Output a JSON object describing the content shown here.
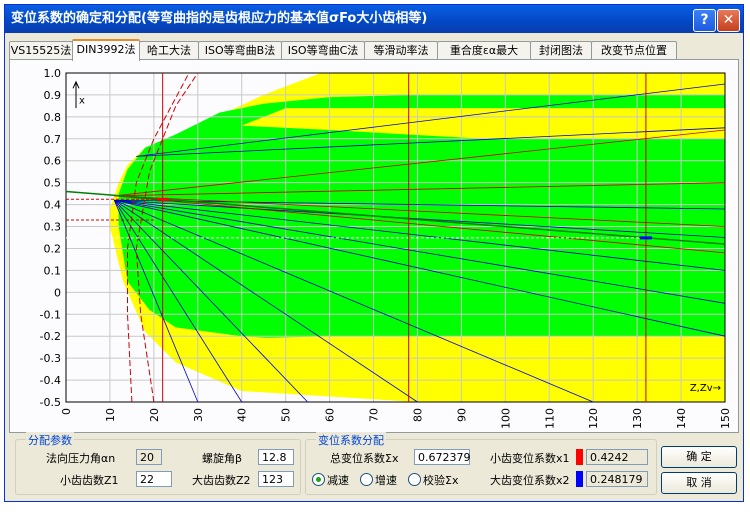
{
  "window": {
    "title": "变位系数的确定和分配(等弯曲指的是齿根应力的基本值σFo大小齿相等)",
    "help_glyph": "?",
    "close_glyph": "✕"
  },
  "tabs": [
    {
      "label": "VS15525法",
      "active": false
    },
    {
      "label": "DIN3992法",
      "active": true
    },
    {
      "label": "哈工大法",
      "active": false
    },
    {
      "label": "ISO等弯曲B法",
      "active": false
    },
    {
      "label": "ISO等弯曲C法",
      "active": false
    },
    {
      "label": "等滑动率法",
      "active": false
    },
    {
      "label": "重合度εα最大",
      "active": false
    },
    {
      "label": "封闭图法",
      "active": false
    },
    {
      "label": "改变节点位置",
      "active": false
    }
  ],
  "chart_data": {
    "type": "line",
    "xlim": [
      0,
      150
    ],
    "ylim": [
      -0.5,
      1.0
    ],
    "x_ticks": [
      "0",
      "10",
      "20",
      "30",
      "40",
      "50",
      "60",
      "70",
      "80",
      "90",
      "100",
      "110",
      "120",
      "130",
      "140",
      "150"
    ],
    "y_ticks": [
      "1.0",
      "0.9",
      "0.8",
      "0.7",
      "0.6",
      "0.5",
      "0.4",
      "0.3",
      "0.2",
      "0.1",
      "0",
      "-0.1",
      "-0.2",
      "-0.3",
      "-0.4",
      "-0.5"
    ],
    "x_axis_label": "Z,Zv",
    "y_axis_label": "x",
    "grid": true,
    "markers": [
      {
        "x": 22,
        "y": 0.4242,
        "color": "#ff0000"
      },
      {
        "x": 132,
        "y": 0.248179,
        "color": "#0000ff"
      }
    ],
    "vertical_lines_x": [
      22,
      78,
      132
    ]
  },
  "colors": {
    "zone_yellow": "#ffff00",
    "zone_green": "#00ff00",
    "small_gear": "#ff0000",
    "large_gear": "#0000ff"
  },
  "dist_params": {
    "title": "分配参数",
    "pressure_angle_label": "法向压力角αn",
    "pressure_angle_value": "20",
    "helix_angle_label": "螺旋角β",
    "helix_angle_value": "12.8",
    "small_teeth_label": "小齿齿数Z1",
    "small_teeth_value": "22",
    "large_teeth_label": "大齿齿数Z2",
    "large_teeth_value": "123"
  },
  "shift_dist": {
    "title": "变位系数分配",
    "total_label": "总变位系数Σx",
    "total_value": "0.672379",
    "x1_label": "小齿变位系数x1",
    "x1_value": "0.4242",
    "x2_label": "大齿变位系数x2",
    "x2_value": "0.248179",
    "radio_options": [
      {
        "label": "减速",
        "checked": true
      },
      {
        "label": "增速",
        "checked": false
      },
      {
        "label": "校验Σx",
        "checked": false
      }
    ]
  },
  "buttons": {
    "ok": "确  定",
    "cancel": "取  消"
  }
}
